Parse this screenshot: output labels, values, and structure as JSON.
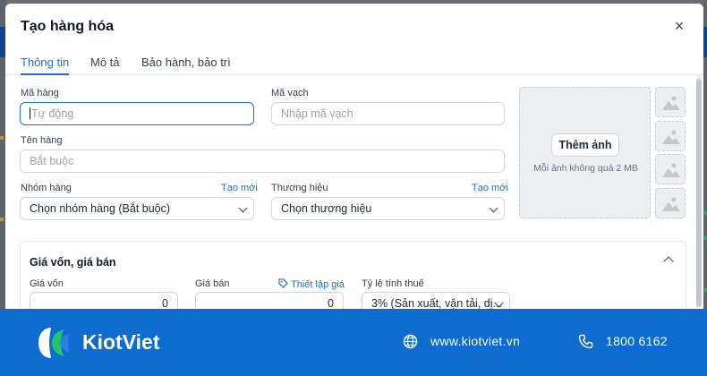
{
  "modal": {
    "title": "Tạo hàng hóa",
    "close_icon": "×"
  },
  "tabs": [
    {
      "label": "Thông tin",
      "active": true
    },
    {
      "label": "Mô tả",
      "active": false
    },
    {
      "label": "Bảo hành, bảo trì",
      "active": false
    }
  ],
  "form": {
    "sku_label": "Mã hàng",
    "sku_placeholder": "Tự động",
    "barcode_label": "Mã vạch",
    "barcode_placeholder": "Nhập mã vạch",
    "name_label": "Tên hàng",
    "name_placeholder": "Bắt buộc",
    "group_label": "Nhóm hàng",
    "group_create_link": "Tạo mới",
    "group_value": "Chọn nhóm hàng (Bắt buộc)",
    "brand_label": "Thương hiệu",
    "brand_create_link": "Tạo mới",
    "brand_value": "Chọn thương hiệu"
  },
  "images": {
    "add_button": "Thêm ảnh",
    "hint": "Mỗi ảnh không quá 2 MB",
    "thumbnail_icon": "image-placeholder-icon"
  },
  "pricing": {
    "title": "Giá vốn, giá bán",
    "cost_label": "Giá vốn",
    "cost_value": "0",
    "price_label": "Giá bán",
    "price_setup_link": "Thiết lập giá",
    "price_value": "0",
    "tax_label": "Tỷ lệ tính thuế",
    "tax_value": "3% (Sản xuất, vận tải, dị..."
  },
  "banner": {
    "brand": "KiotViet",
    "website": "www.kiotviet.vn",
    "phone": "1800 6162"
  },
  "colors": {
    "accent": "#1d6fd8",
    "banner": "#0e6bd0"
  }
}
